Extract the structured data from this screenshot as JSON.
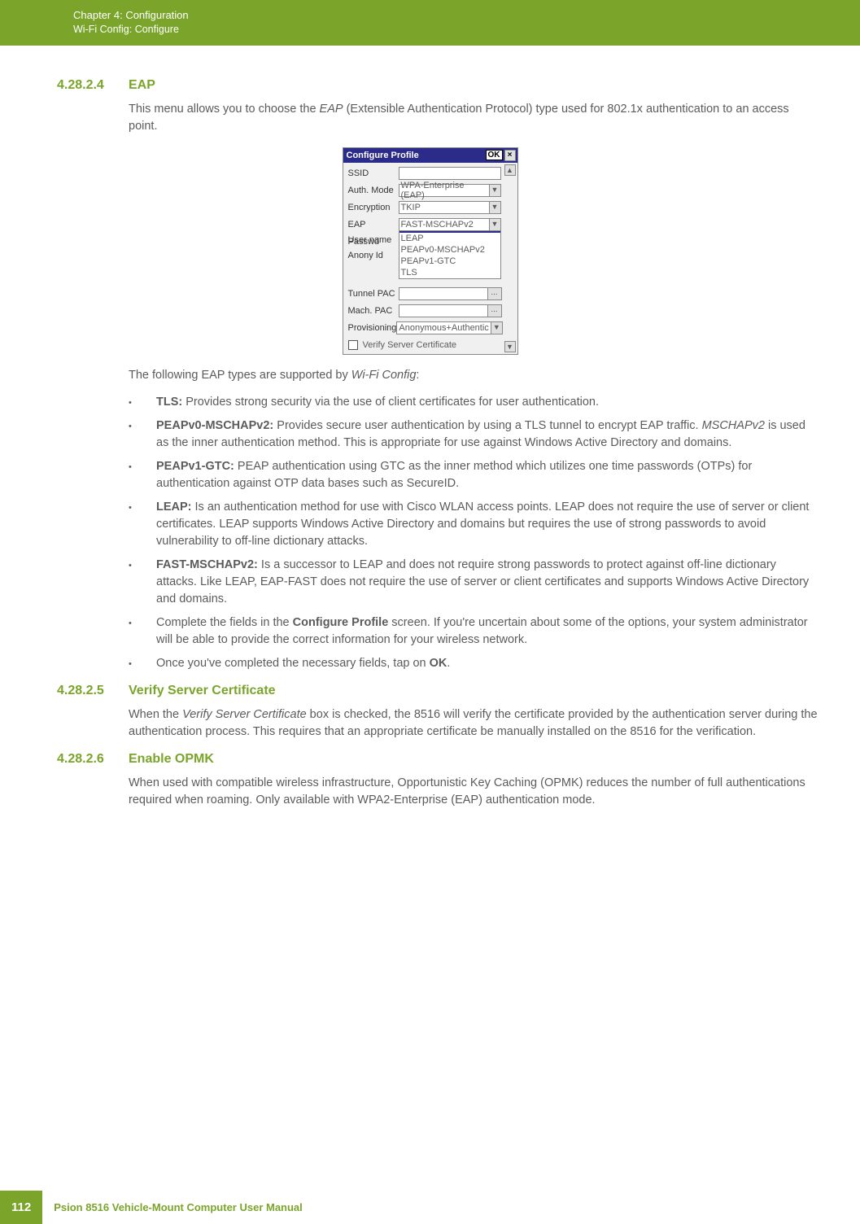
{
  "header": {
    "title": "Chapter 4:  Configuration",
    "subtitle": "Wi-Fi Config: Configure"
  },
  "sections": [
    {
      "num": "4.28.2.4",
      "title": "EAP",
      "intro": "This menu allows you to choose the ",
      "intro_italic": "EAP",
      "intro_cont": " (Extensible Authentication Protocol) type used for 802.1x authentication to an access point.",
      "after_img_pre": "The following EAP types are supported by ",
      "after_img_italic": "Wi-Fi Config",
      "after_img_post": ":",
      "bullets": [
        {
          "lead": "TLS:",
          "text": " Provides strong security via the use of client certificates for user authentication."
        },
        {
          "lead": "PEAPv0-MSCHAPv2:",
          "text": " Provides secure user authentication by using a TLS tunnel to encrypt EAP traffic. ",
          "mid_italic": "MSCHAPv2",
          "text2": " is used as the inner authentication method. This is appropriate for use against Windows Active Directory and domains."
        },
        {
          "lead": "PEAPv1-GTC:",
          "text": " PEAP authentication using GTC as the inner method which utilizes one time passwords (OTPs) for authentication against OTP data bases such as SecureID."
        },
        {
          "lead": "LEAP:",
          "text": " Is an authentication method for use with Cisco WLAN access points. LEAP does not require the use of server or client certificates. LEAP supports Windows Active Directory and domains but requires the use of strong passwords to avoid vulnerability to off-line dictionary attacks."
        },
        {
          "lead": "FAST-MSCHAPv2:",
          "text": " Is a successor to LEAP and does not require strong passwords to protect against off-line dictionary attacks. Like LEAP, EAP-FAST does not require the use of server or client certificates and supports Windows Active Directory and domains."
        },
        {
          "plain_pre": "Complete the fields in the ",
          "bold_mid": "Configure Profile",
          "plain_post": " screen. If you're uncertain about some of the options, your system administrator will be able to provide the correct information for your wireless network."
        },
        {
          "plain_pre": "Once you've completed the necessary fields, tap on ",
          "bold_mid": "OK",
          "plain_post": "."
        }
      ]
    },
    {
      "num": "4.28.2.5",
      "title": "Verify Server Certificate",
      "body_pre": "When the ",
      "body_italic": "Verify Server Certificate",
      "body_post": " box is checked, the 8516 will verify the certificate provided by the authentication server during the authentication process. This requires that an appropriate certificate be manually installed on the 8516 for the verification."
    },
    {
      "num": "4.28.2.6",
      "title": "Enable OPMK",
      "body": "When used with compatible wireless infrastructure, Opportunistic Key Caching (OPMK) reduces the number of full authentications required when roaming. Only available with WPA2-Enterprise (EAP) authentication mode."
    }
  ],
  "dialog": {
    "title": "Configure Profile",
    "ok": "OK",
    "close": "×",
    "labels": {
      "ssid": "SSID",
      "auth": "Auth. Mode",
      "enc": "Encryption",
      "eap": "EAP",
      "user": "User name",
      "pass": "Passwd",
      "anony": "Anony Id",
      "tunnel": "Tunnel PAC",
      "mach": "Mach. PAC",
      "prov": "Provisioning",
      "verify": "Verify Server Certificate"
    },
    "values": {
      "auth": "WPA-Enterprise (EAP)",
      "enc": "TKIP",
      "eap": "FAST-MSCHAPv2",
      "prov": "Anonymous+Authentic"
    },
    "eap_options": [
      "FAST-MSCHAPv2",
      "LEAP",
      "PEAPv0-MSCHAPv2",
      "PEAPv1-GTC",
      "TLS"
    ],
    "browse": "..."
  },
  "footer": {
    "page": "112",
    "text": "Psion 8516 Vehicle-Mount Computer User Manual"
  }
}
